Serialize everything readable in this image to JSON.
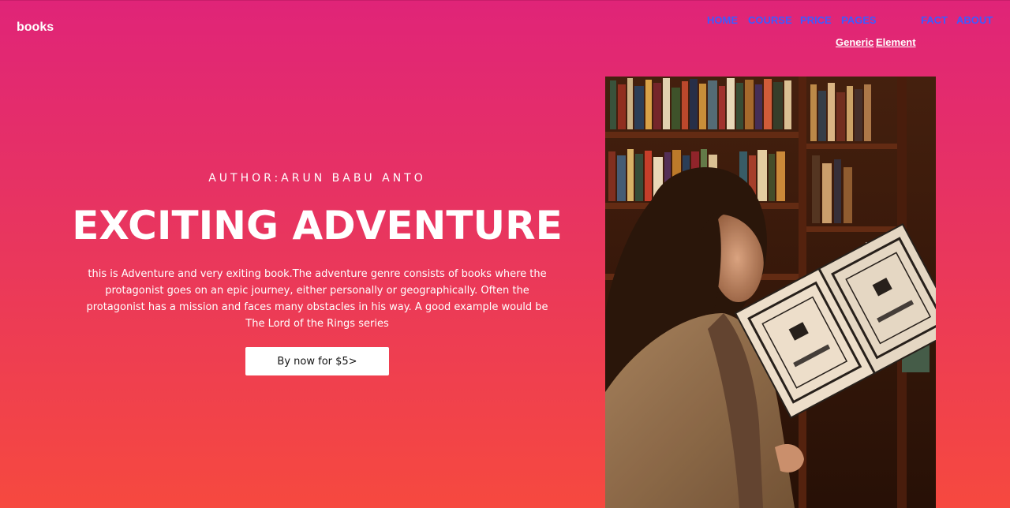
{
  "brand": "books",
  "nav": {
    "home": "HOME",
    "course": "COURSE",
    "price": "PRICE",
    "pages": "PAGES",
    "fact": "FACT",
    "about": "ABOUT"
  },
  "subnav": {
    "generic": "Generic",
    "element": "Element"
  },
  "hero": {
    "author": "author:Arun Babu Anto",
    "title": "EXCITING ADVENTURE",
    "description": "this is Adventure and very exiting book.The adventure genre consists of books where the protagonist goes on an epic journey, either personally or geographically. Often the protagonist has a mission and faces many obstacles in his way. A good example would be The Lord of the Rings series",
    "button_label": "By now for $5>"
  },
  "colors": {
    "gradient_top": "#e02478",
    "gradient_bottom": "#f6493f",
    "nav_link": "#3d5bff"
  }
}
